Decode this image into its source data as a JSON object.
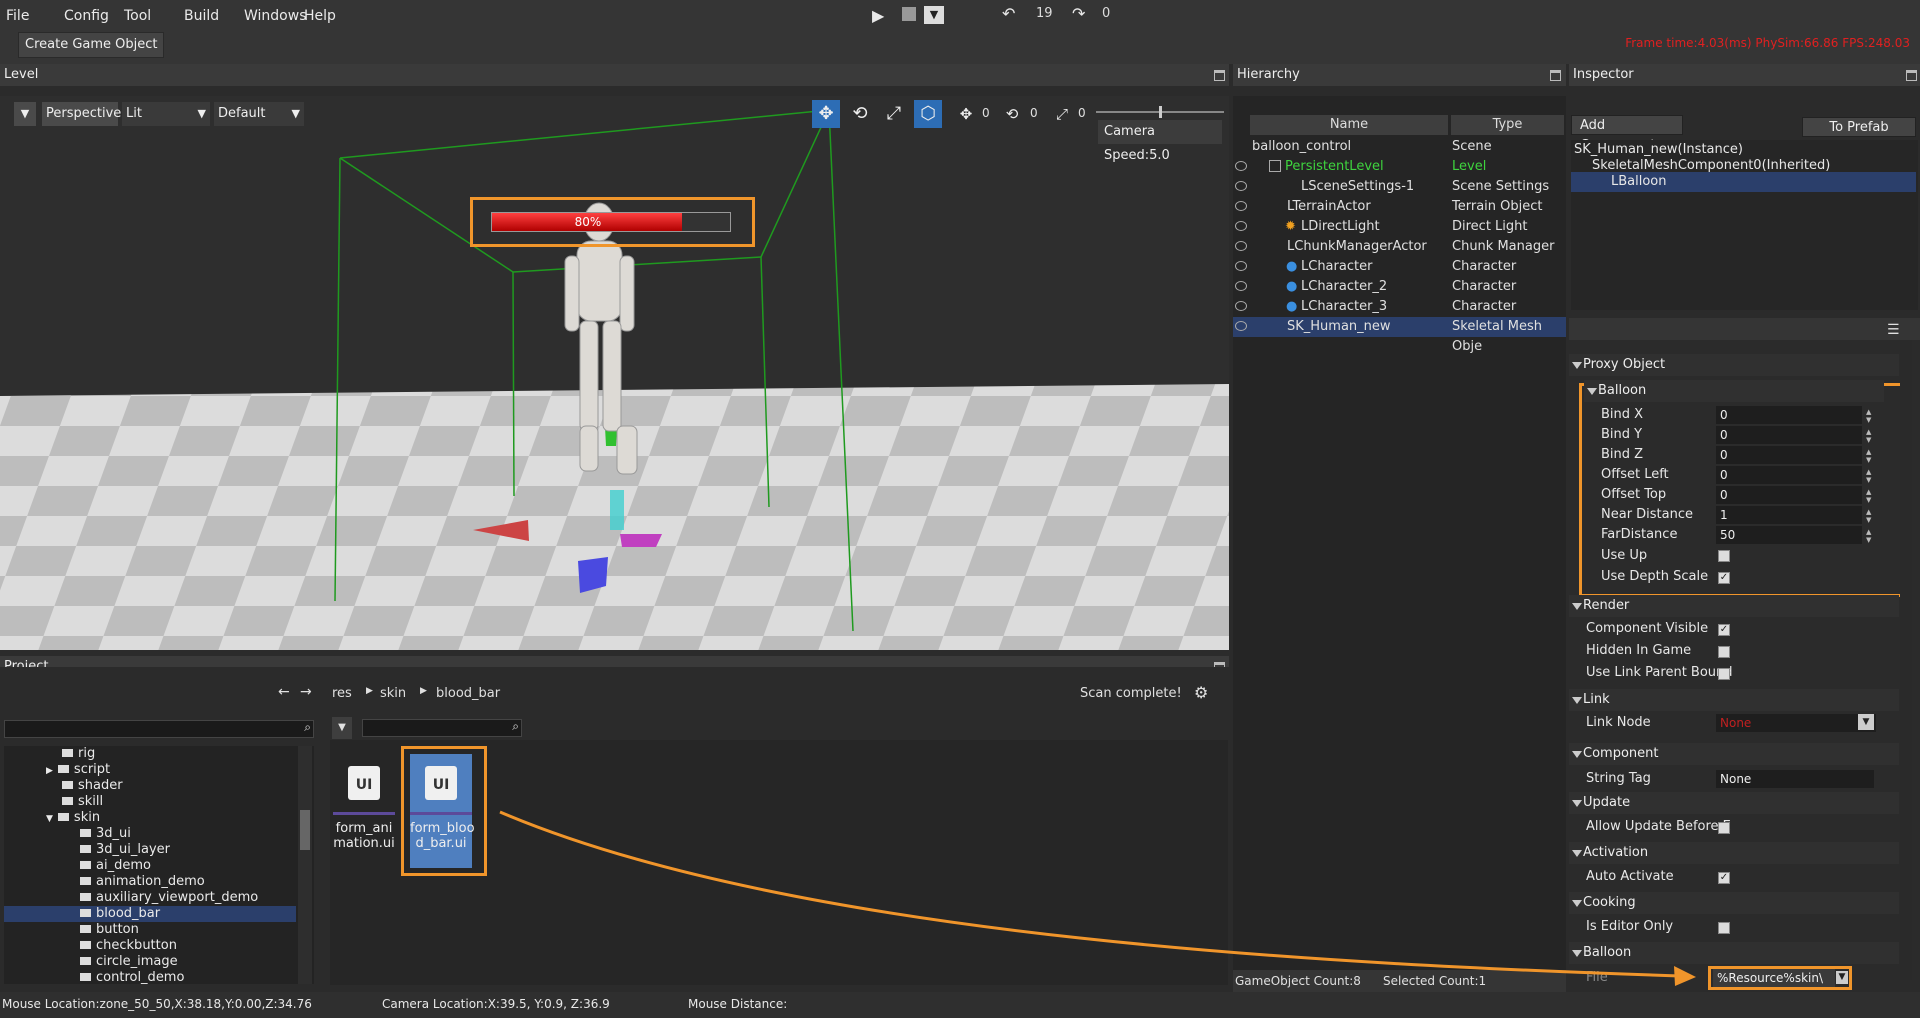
{
  "menu": [
    "File",
    "Config",
    "Tool",
    "Build",
    "Windows",
    "Help"
  ],
  "toolbar": {
    "undo_count": "19",
    "redo_count": "0",
    "create_game_object": "Create Game Object"
  },
  "frame_stats": "Frame time:4.03(ms)  PhySim:66.86  FPS:248.03",
  "level": {
    "title": "Level",
    "view": "Perspective",
    "shading": "Lit",
    "mode": "Default",
    "move_count": "0",
    "rotate_count": "0",
    "scale_count": "0",
    "camera_speed": "Camera Speed:5.0",
    "health_text": "80%",
    "health_progress": 0.8
  },
  "hierarchy": {
    "title": "Hierarchy",
    "col_name": "Name",
    "col_type": "Type",
    "rows": [
      {
        "name": "balloon_control",
        "type": "Scene"
      },
      {
        "name": "PersistentLevel",
        "type": "Level"
      },
      {
        "name": "LSceneSettings-1",
        "type": "Scene Settings"
      },
      {
        "name": "LTerrainActor",
        "type": "Terrain Object"
      },
      {
        "name": "LDirectLight",
        "type": "Direct Light"
      },
      {
        "name": "LChunkManagerActor",
        "type": "Chunk Manager"
      },
      {
        "name": "LCharacter",
        "type": "Character"
      },
      {
        "name": "LCharacter_2",
        "type": "Character"
      },
      {
        "name": "LCharacter_3",
        "type": "Character"
      },
      {
        "name": "SK_Human_new",
        "type": "Skeletal Mesh Obje"
      }
    ],
    "footer_count": "GameObject Count:8",
    "footer_selected": "Selected Count:1"
  },
  "inspector": {
    "title": "Inspector",
    "add_component": "Add Component",
    "to_prefab": "To Prefab",
    "tree": [
      "SK_Human_new(Instance)",
      "SkeletalMeshComponent0(Inherited)",
      "LBalloon"
    ],
    "proxy_section": "Proxy Object",
    "balloon_section": "Balloon",
    "props": [
      {
        "label": "Bind X",
        "value": "0"
      },
      {
        "label": "Bind Y",
        "value": "0"
      },
      {
        "label": "Bind Z",
        "value": "0"
      },
      {
        "label": "Offset Left",
        "value": "0"
      },
      {
        "label": "Offset Top",
        "value": "0"
      },
      {
        "label": "Near Distance",
        "value": "1"
      },
      {
        "label": "FarDistance",
        "value": "50"
      }
    ],
    "use_up": "Use Up",
    "use_depth_scale": "Use Depth Scale",
    "render_section": "Render",
    "component_visible": "Component Visible",
    "hidden_in_game": "Hidden In Game",
    "use_link_parent": "Use Link Parent Bound",
    "link_section": "Link",
    "link_node": "Link Node",
    "link_node_value": "None",
    "component_section": "Component",
    "string_tag": "String Tag",
    "string_tag_value": "None",
    "update_section": "Update",
    "allow_update": "Allow Update Before E",
    "activation_section": "Activation",
    "auto_activate": "Auto Activate",
    "cooking_section": "Cooking",
    "is_editor_only": "Is Editor Only",
    "balloon2_section": "Balloon",
    "file_label": "File",
    "file_value": "%Resource%skin\\"
  },
  "project": {
    "title": "Project",
    "breadcrumb": [
      "res",
      "skin",
      "blood_bar"
    ],
    "scan": "Scan complete!",
    "tree": [
      "rig",
      "script",
      "shader",
      "skill",
      "skin",
      "3d_ui",
      "3d_ui_layer",
      "ai_demo",
      "animation_demo",
      "auxiliary_viewport_demo",
      "blood_bar",
      "button",
      "checkbutton",
      "circle_image",
      "control_demo"
    ],
    "assets": [
      "form_ani mation.ui",
      "form_bloo d_bar.ui"
    ],
    "asset_icon": "UI"
  },
  "status": {
    "mouse": "Mouse Location:zone_50_50,X:38.18,Y:0.00,Z:34.76",
    "camera": "Camera Location:X:39.5, Y:0.9, Z:36.9",
    "distance": "Mouse Distance:"
  },
  "colors": {
    "accent_orange": "#f0952b",
    "selection": "#2b3f6b",
    "level_green": "#3ed43e",
    "error_red": "#e02020"
  }
}
